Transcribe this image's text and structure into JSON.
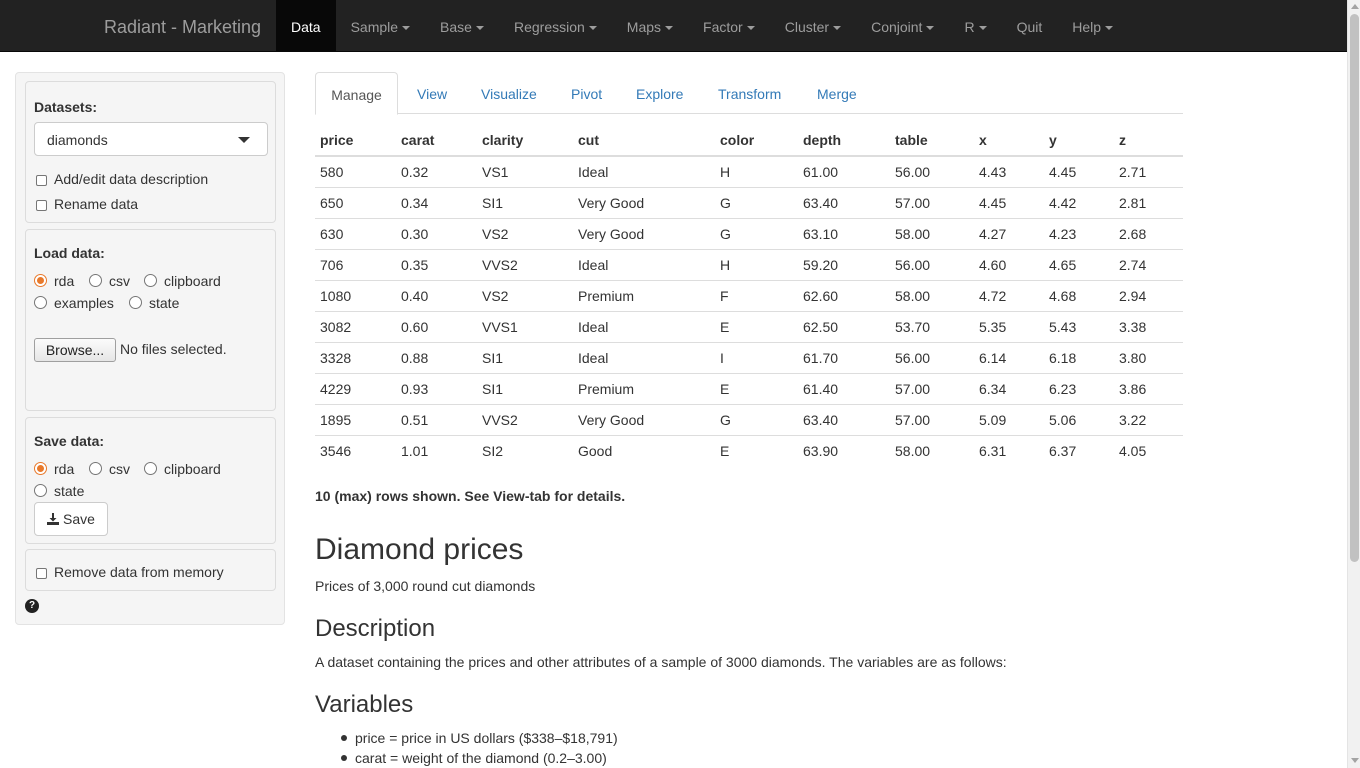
{
  "navbar": {
    "brand": "Radiant - Marketing",
    "items": [
      {
        "label": "Data",
        "dropdown": false
      },
      {
        "label": "Sample",
        "dropdown": true
      },
      {
        "label": "Base",
        "dropdown": true
      },
      {
        "label": "Regression",
        "dropdown": true
      },
      {
        "label": "Maps",
        "dropdown": true
      },
      {
        "label": "Factor",
        "dropdown": true
      },
      {
        "label": "Cluster",
        "dropdown": true
      },
      {
        "label": "Conjoint",
        "dropdown": true
      },
      {
        "label": "R",
        "dropdown": true
      },
      {
        "label": "Quit",
        "dropdown": false
      },
      {
        "label": "Help",
        "dropdown": true
      }
    ]
  },
  "sidebar": {
    "datasets_label": "Datasets:",
    "dataset_selected": "diamonds",
    "add_edit_label": "Add/edit data description",
    "rename_label": "Rename data",
    "load_label": "Load data:",
    "load_options": [
      "rda",
      "csv",
      "clipboard",
      "examples",
      "state"
    ],
    "load_selected": "rda",
    "browse_label": "Browse...",
    "no_files": "No files selected.",
    "save_label": "Save data:",
    "save_options": [
      "rda",
      "csv",
      "clipboard",
      "state"
    ],
    "save_selected": "rda",
    "save_button": "Save",
    "remove_label": "Remove data from memory",
    "help_glyph": "?"
  },
  "tabs": [
    "Manage",
    "View",
    "Visualize",
    "Pivot",
    "Explore",
    "Transform",
    "Merge"
  ],
  "active_tab": "Manage",
  "table": {
    "columns": [
      "price",
      "carat",
      "clarity",
      "cut",
      "color",
      "depth",
      "table",
      "x",
      "y",
      "z"
    ],
    "rows": [
      [
        "580",
        "0.32",
        "VS1",
        "Ideal",
        "H",
        "61.00",
        "56.00",
        "4.43",
        "4.45",
        "2.71"
      ],
      [
        "650",
        "0.34",
        "SI1",
        "Very Good",
        "G",
        "63.40",
        "57.00",
        "4.45",
        "4.42",
        "2.81"
      ],
      [
        "630",
        "0.30",
        "VS2",
        "Very Good",
        "G",
        "63.10",
        "58.00",
        "4.27",
        "4.23",
        "2.68"
      ],
      [
        "706",
        "0.35",
        "VVS2",
        "Ideal",
        "H",
        "59.20",
        "56.00",
        "4.60",
        "4.65",
        "2.74"
      ],
      [
        "1080",
        "0.40",
        "VS2",
        "Premium",
        "F",
        "62.60",
        "58.00",
        "4.72",
        "4.68",
        "2.94"
      ],
      [
        "3082",
        "0.60",
        "VVS1",
        "Ideal",
        "E",
        "62.50",
        "53.70",
        "5.35",
        "5.43",
        "3.38"
      ],
      [
        "3328",
        "0.88",
        "SI1",
        "Ideal",
        "I",
        "61.70",
        "56.00",
        "6.14",
        "6.18",
        "3.80"
      ],
      [
        "4229",
        "0.93",
        "SI1",
        "Premium",
        "E",
        "61.40",
        "57.00",
        "6.34",
        "6.23",
        "3.86"
      ],
      [
        "1895",
        "0.51",
        "VVS2",
        "Very Good",
        "G",
        "63.40",
        "57.00",
        "5.09",
        "5.06",
        "3.22"
      ],
      [
        "3546",
        "1.01",
        "SI2",
        "Good",
        "E",
        "63.90",
        "58.00",
        "6.31",
        "6.37",
        "4.05"
      ]
    ]
  },
  "rows_note": "10 (max) rows shown. See View-tab for details.",
  "description": {
    "title": "Diamond prices",
    "subtitle": "Prices of 3,000 round cut diamonds",
    "section_title": "Description",
    "section_text": "A dataset containing the prices and other attributes of a sample of 3000 diamonds. The variables are as follows:",
    "variables_title": "Variables",
    "variables": [
      "price = price in US dollars ($338–$18,791)",
      "carat = weight of the diamond (0.2–3.00)"
    ]
  },
  "colors": {
    "navbar_bg": "#222222",
    "link": "#337ab7",
    "radio_accent": "#e8792b"
  }
}
